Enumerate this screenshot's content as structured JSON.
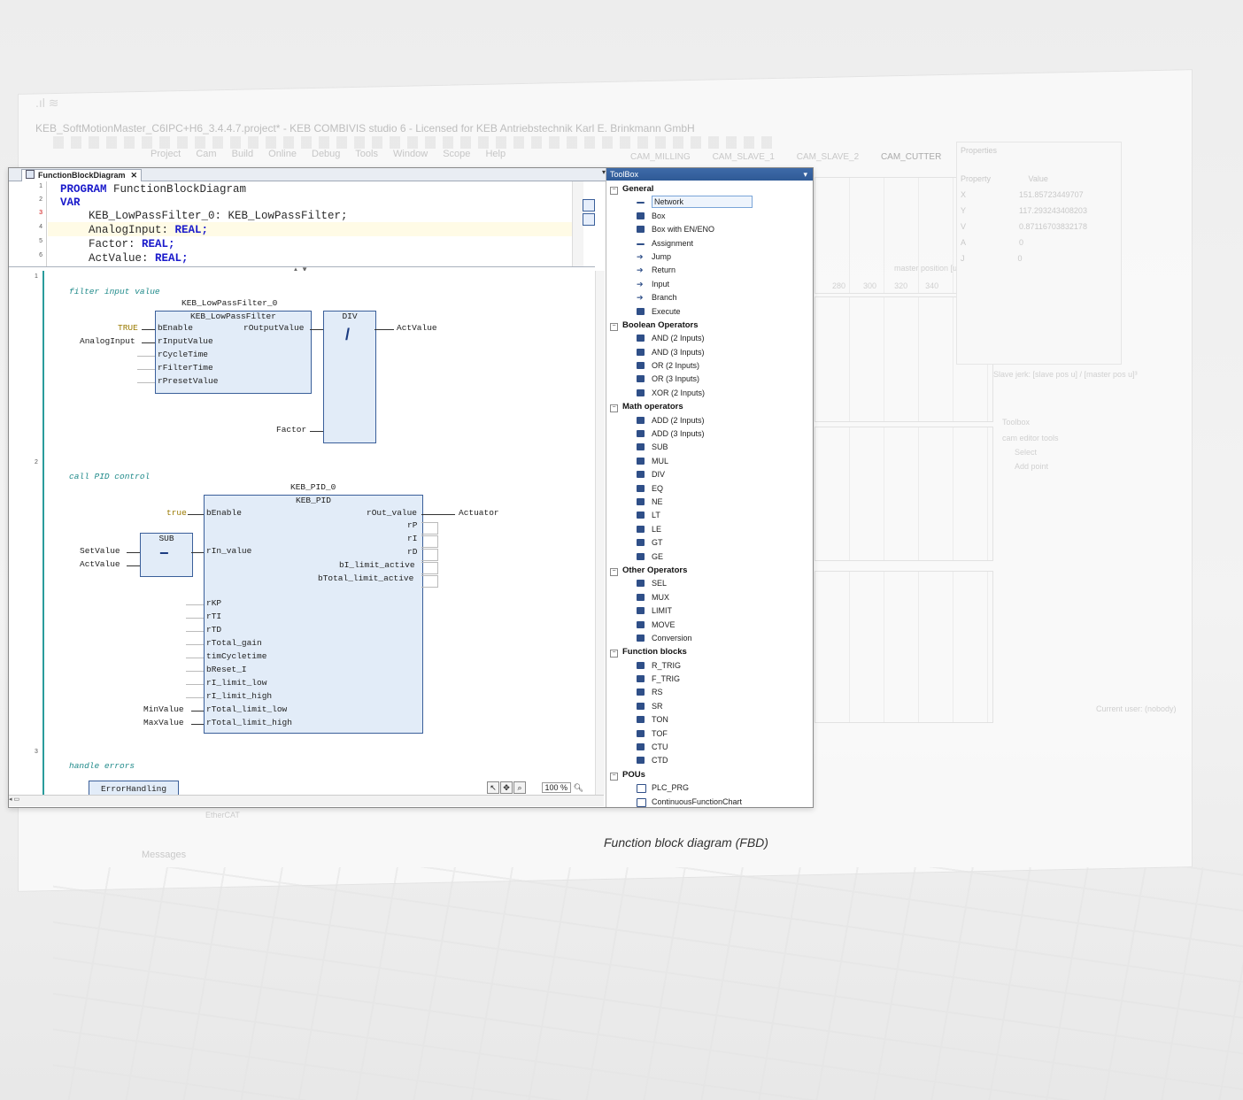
{
  "background": {
    "titlebar": "KEB_SoftMotionMaster_C6IPC+H6_3.4.4.7.project* - KEB COMBIVIS studio 6 - Licensed for KEB Antriebstechnik Karl E. Brinkmann GmbH",
    "menu": [
      "Project",
      "Cam",
      "Build",
      "Online",
      "Debug",
      "Tools",
      "Window",
      "Scope",
      "Help"
    ],
    "tabs": [
      "CAM_MILLING",
      "CAM_SLAVE_1",
      "CAM_SLAVE_2",
      "CAM_CUTTER"
    ],
    "properties_title": "Properties",
    "properties_header": [
      "Property",
      "Value"
    ],
    "properties_rows": [
      [
        "X",
        "151.85723449707"
      ],
      [
        "Y",
        "117.293243408203"
      ],
      [
        "V",
        "0.87116703832178"
      ],
      [
        "A",
        "0"
      ],
      [
        "J",
        "0"
      ]
    ],
    "slave_jerk": "Slave jerk: [slave pos u] / [master pos u]³",
    "toolbox_title": "Toolbox",
    "cam_tools": "cam editor tools",
    "select": "Select",
    "add_point": "Add point",
    "master_pos": "master position [u]",
    "axis_ticks": [
      "280",
      "300",
      "320",
      "340"
    ],
    "current_user": "Current user: (nobody)",
    "ethercat": "EtherCAT",
    "messages": "Messages"
  },
  "editor": {
    "tab_label": "FunctionBlockDiagram",
    "declaration": {
      "lines": [
        {
          "num": "1",
          "kw": "PROGRAM",
          "rest": " FunctionBlockDiagram"
        },
        {
          "num": "2",
          "kw": "VAR",
          "rest": ""
        },
        {
          "num": "3",
          "name": "KEB_LowPassFilter_0: KEB_LowPassFilter;",
          "type": ""
        },
        {
          "num": "4",
          "name": "AnalogInput: ",
          "type": "REAL;"
        },
        {
          "num": "5",
          "name": "Factor: ",
          "type": "REAL;"
        },
        {
          "num": "6",
          "name": "ActValue: ",
          "type": "REAL;"
        }
      ]
    },
    "networks": [
      {
        "num": "1",
        "comment": "filter input value",
        "instance": "KEB_LowPassFilter_0",
        "fb_type": "KEB_LowPassFilter",
        "inputs": [
          "bEnable",
          "rInputValue",
          "rCycleTime",
          "rFilterTime",
          "rPresetValue"
        ],
        "output": "rOutputValue",
        "in_true": "TRUE",
        "in_analog": "AnalogInput",
        "op_name": "DIV",
        "op_symbol": "/",
        "op_in": "Factor",
        "op_out": "ActValue"
      },
      {
        "num": "2",
        "comment": "call PID control",
        "instance": "KEB_PID_0",
        "fb_type": "KEB_PID",
        "in_true": "true",
        "in_enable": "bEnable",
        "in_value": "rIn_value",
        "sub_name": "SUB",
        "sub_symbol": "−",
        "sub_in1": "SetValue",
        "sub_in2": "ActValue",
        "out_value": "rOut_value",
        "out_target": "Actuator",
        "outputs": [
          "rP",
          "rI",
          "rD",
          "bI_limit_active",
          "bTotal_limit_active"
        ],
        "params": [
          "rKP",
          "rTI",
          "rTD",
          "rTotal_gain",
          "timCycletime",
          "bReset_I",
          "rI_limit_low",
          "rI_limit_high",
          "rTotal_limit_low",
          "rTotal_limit_high"
        ],
        "min_in": "MinValue",
        "max_in": "MaxValue"
      },
      {
        "num": "3",
        "comment": "handle errors",
        "block": "ErrorHandling"
      }
    ],
    "zoom": "100 %"
  },
  "toolbox": {
    "title": "ToolBox",
    "categories": [
      {
        "name": "General",
        "items": [
          "Network",
          "Box",
          "Box with EN/ENO",
          "Assignment",
          "Jump",
          "Return",
          "Input",
          "Branch",
          "Execute"
        ]
      },
      {
        "name": "Boolean Operators",
        "items": [
          "AND (2 Inputs)",
          "AND (3 Inputs)",
          "OR (2 Inputs)",
          "OR (3 Inputs)",
          "XOR (2 Inputs)"
        ]
      },
      {
        "name": "Math operators",
        "items": [
          "ADD (2 Inputs)",
          "ADD (3 Inputs)",
          "SUB",
          "MUL",
          "DIV",
          "EQ",
          "NE",
          "LT",
          "LE",
          "GT",
          "GE"
        ]
      },
      {
        "name": "Other Operators",
        "items": [
          "SEL",
          "MUX",
          "LIMIT",
          "MOVE",
          "Conversion"
        ]
      },
      {
        "name": "Function blocks",
        "items": [
          "R_TRIG",
          "F_TRIG",
          "RS",
          "SR",
          "TON",
          "TOF",
          "CTU",
          "CTD"
        ]
      },
      {
        "name": "POUs",
        "items": [
          "PLC_PRG",
          "ContinuousFunctionChart"
        ]
      }
    ]
  },
  "caption": "Function block diagram (FBD)"
}
